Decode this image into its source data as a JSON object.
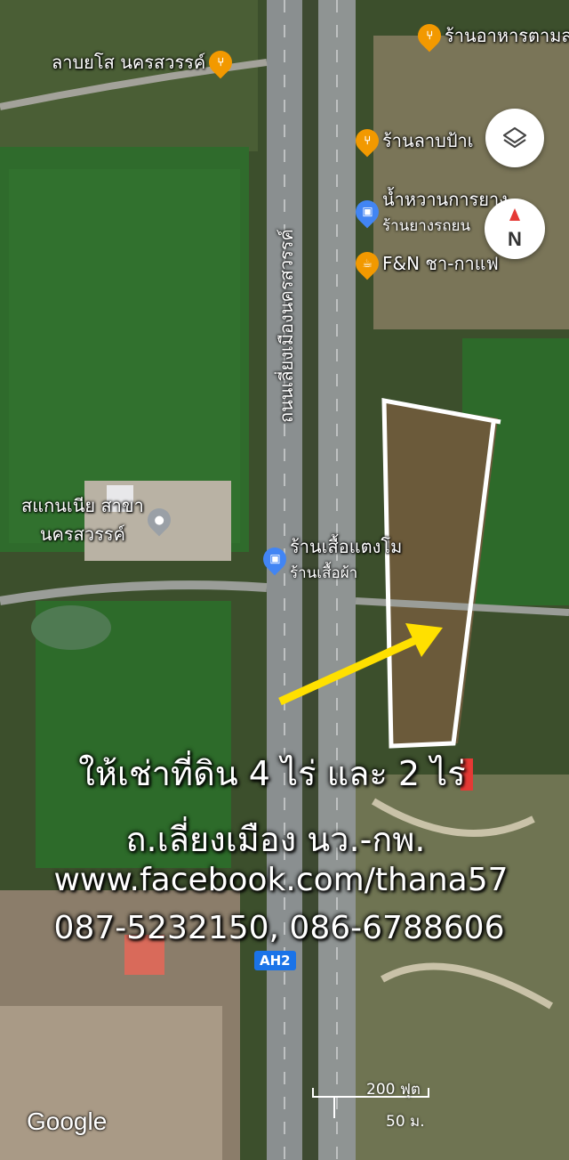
{
  "pois": [
    {
      "id": "poi-restaurant-top",
      "name": "ร้านอาหารตามส",
      "sub": "",
      "kind": "food",
      "icon": "fork-knife-icon"
    },
    {
      "id": "poi-laab-yoso",
      "name": "ลาบยโส นครสวรรค์",
      "sub": "",
      "kind": "food",
      "icon": "fork-knife-icon"
    },
    {
      "id": "poi-laab-pa",
      "name": "ร้านลาบป้าเ",
      "sub": "",
      "kind": "food",
      "icon": "fork-knife-icon"
    },
    {
      "id": "poi-namwan",
      "name": "น้ำหวานการยาง",
      "sub": "ร้านยางรถยน",
      "kind": "shop",
      "icon": "shopping-bag-icon"
    },
    {
      "id": "poi-fn-cafe",
      "name": "F&N ชา-กาแฟ",
      "sub": "",
      "kind": "cafe",
      "icon": "coffee-cup-icon"
    },
    {
      "id": "poi-scania",
      "name": "สแกนเนีย สาขา",
      "sub": "นครสวรรค์",
      "kind": "place",
      "icon": "map-pin-icon"
    },
    {
      "id": "poi-shirt-shop",
      "name": "ร้านเสื้อแตงโม",
      "sub": "ร้านเสื้อผ้า",
      "kind": "shop",
      "icon": "shopping-bag-icon"
    }
  ],
  "road_label": "ถนนเลี่ยงเมืองนครสวรรค์",
  "highway_shield": "AH2",
  "compass_letter": "N",
  "overlay": {
    "line1": "ให้เช่าที่ดิน 4 ไร่ และ 2 ไร่",
    "line2": "ถ.เลี่ยงเมือง นว.-กพ.",
    "line3": "www.facebook.com/thana57",
    "line4": "087-5232150, 086-6788606"
  },
  "scale": {
    "top": "200 ฟุต",
    "bottom": "50 ม."
  },
  "attribution": "Google",
  "colors": {
    "food": "#f29900",
    "shop": "#4285f4",
    "arrow": "#ffe000",
    "outline": "#ffffff",
    "marker": "#e53935"
  }
}
